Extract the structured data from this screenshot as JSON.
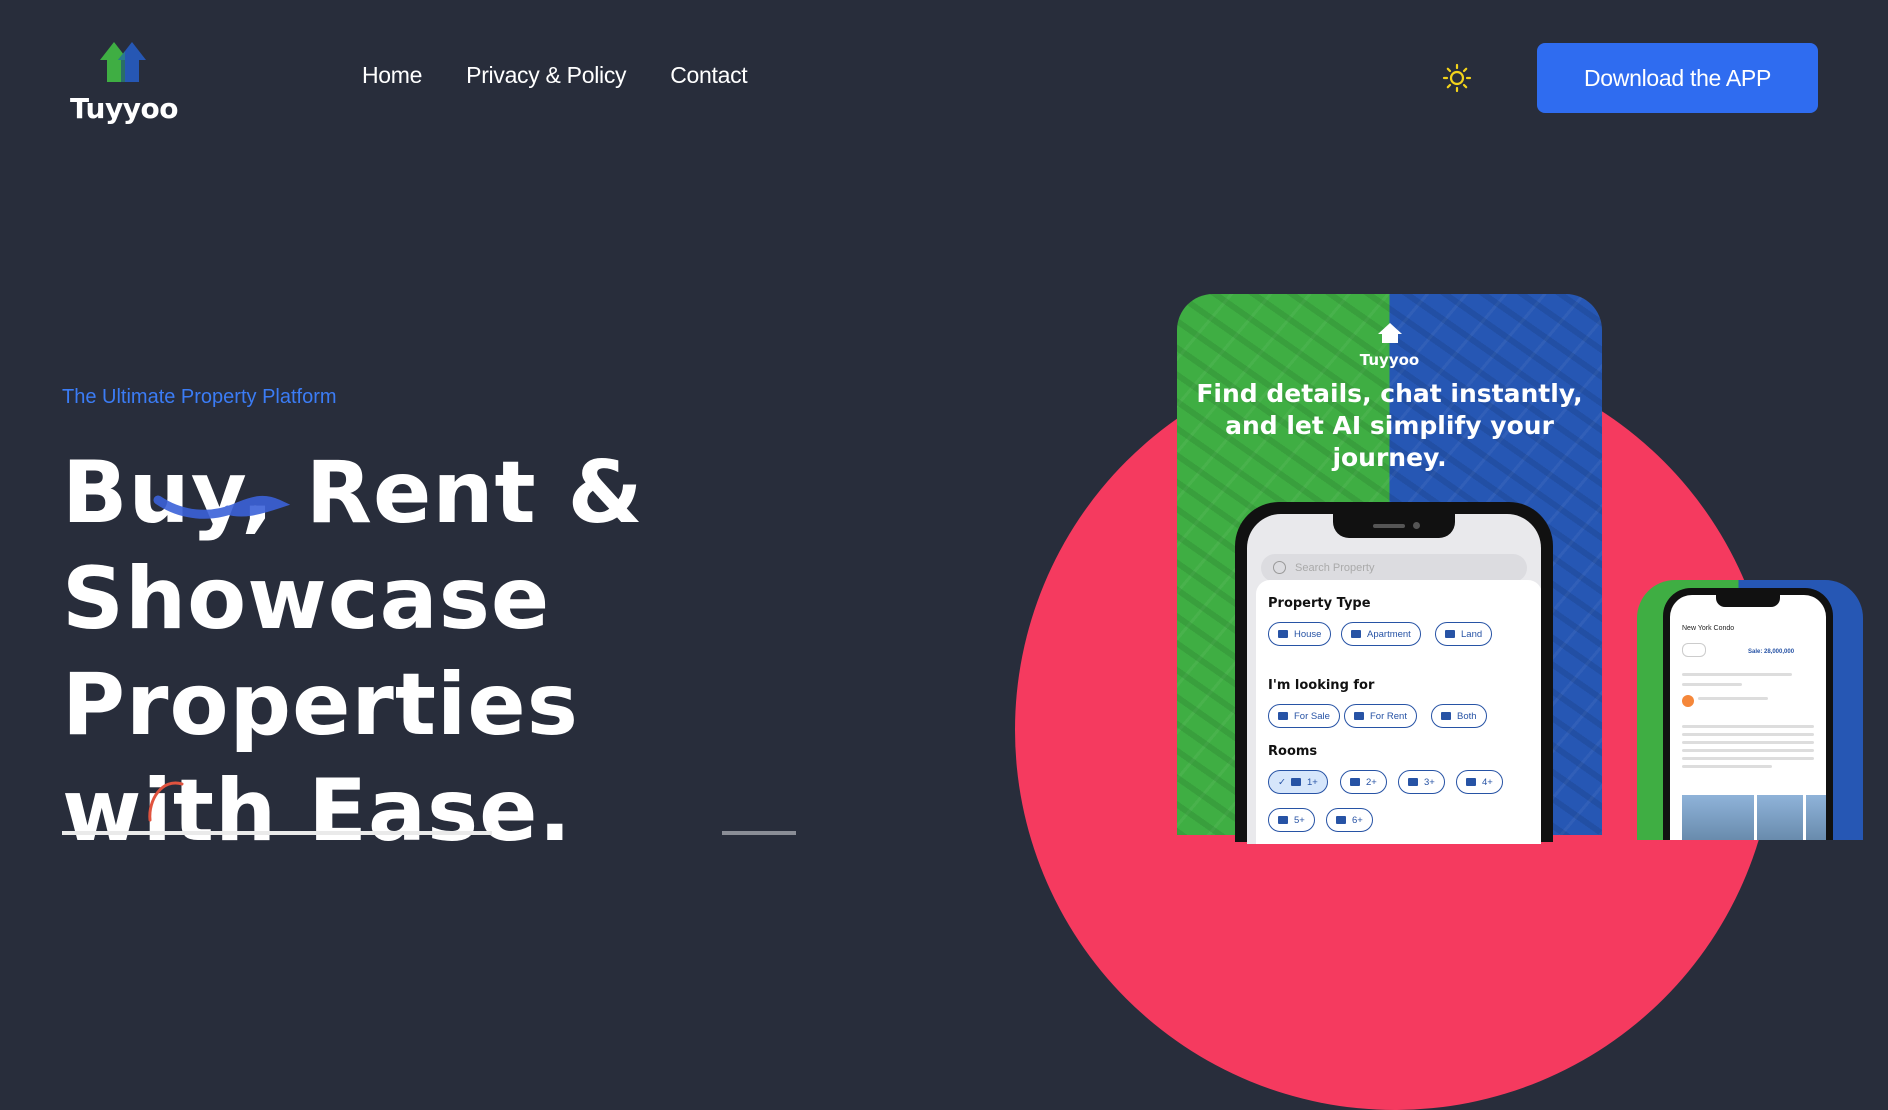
{
  "header": {
    "brand": "Tuyyoo",
    "nav": [
      "Home",
      "Privacy & Policy",
      "Contact"
    ],
    "download_label": "Download the APP",
    "theme_icon": "sun-icon"
  },
  "hero": {
    "tagline": "The Ultimate Property Platform",
    "title_lines": [
      "Buy, Rent &",
      "Showcase",
      "Properties",
      "with Ease."
    ]
  },
  "app_card": {
    "brand": "Tuyyoo",
    "headline_lines": [
      "Find details, chat instantly,",
      "and let AI simplify your journey."
    ],
    "search_placeholder": "Search Property",
    "property_type_label": "Property Type",
    "property_types": [
      "House",
      "Apartment",
      "Land"
    ],
    "looking_for_label": "I'm looking for",
    "looking_for": [
      "For Sale",
      "For Rent",
      "Both"
    ],
    "rooms_label": "Rooms",
    "rooms": [
      "1+",
      "2+",
      "3+",
      "4+",
      "5+",
      "6+"
    ],
    "rooms_selected": "1+"
  },
  "second_phone": {
    "title": "New York Condo",
    "price": "Sale: 28,000,000"
  },
  "colors": {
    "background": "#282d3b",
    "accent_blue": "#2f6cf0",
    "circle_red": "#f53a5f",
    "green": "#3fae43",
    "card_blue": "#2657b4",
    "sun_yellow": "#f2d21b"
  }
}
